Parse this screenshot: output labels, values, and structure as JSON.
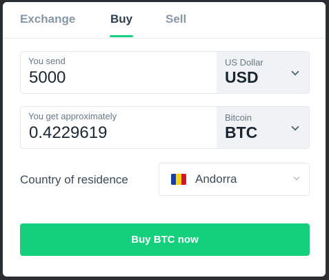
{
  "tabs": [
    {
      "label": "Exchange",
      "active": false
    },
    {
      "label": "Buy",
      "active": true
    },
    {
      "label": "Sell",
      "active": false
    }
  ],
  "send": {
    "label": "You send",
    "value": "5000",
    "currency_name": "US Dollar",
    "currency_code": "USD"
  },
  "get": {
    "label": "You get approximately",
    "value": "0.4229619",
    "currency_name": "Bitcoin",
    "currency_code": "BTC"
  },
  "country": {
    "label": "Country of residence",
    "selected": "Andorra",
    "flag_colors": [
      "#1b3fa0",
      "#f7d20f",
      "#d4122c"
    ]
  },
  "buy_button": {
    "label": "Buy BTC now"
  },
  "colors": {
    "accent": "#14d07c",
    "text_dark": "#1c2630",
    "tab_inactive": "#8797a6"
  },
  "icons": [
    "chevron-down-icon",
    "andorra-flag-icon"
  ]
}
